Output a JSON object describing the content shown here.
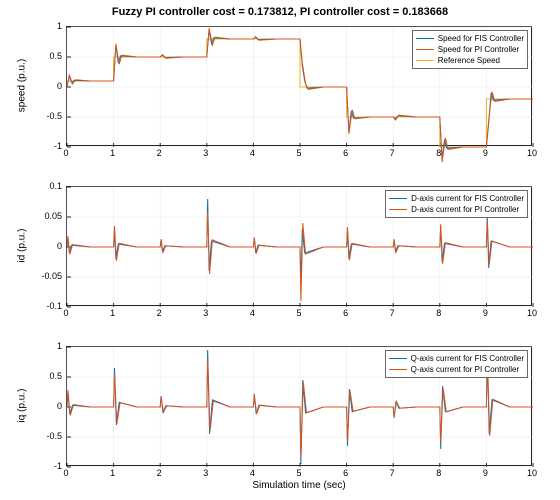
{
  "title": "Fuzzy PI controller cost = 0.173812, PI controller cost = 0.183668",
  "xlabel": "Simulation time (sec)",
  "colors": {
    "c1": "#0072BD",
    "c2": "#D95319",
    "c3": "#EDB120"
  },
  "panel1": {
    "ylabel": "speed (p.u.)",
    "xlim": [
      0,
      10
    ],
    "ylim": [
      -1,
      1
    ],
    "yticks": [
      -1,
      -0.5,
      0,
      0.5,
      1
    ],
    "legend": [
      "Speed for FIS Controller",
      "Speed for PI Controller",
      "Reference Speed"
    ]
  },
  "panel2": {
    "ylabel": "id (p.u.)",
    "xlim": [
      0,
      10
    ],
    "ylim": [
      -0.1,
      0.1
    ],
    "yticks": [
      -0.1,
      -0.05,
      0,
      0.05,
      0.1
    ],
    "legend": [
      "D-axis current for FIS Controller",
      "D-axis current for PI Controller"
    ]
  },
  "panel3": {
    "ylabel": "iq (p.u.)",
    "xlim": [
      0,
      10
    ],
    "ylim": [
      -1,
      1
    ],
    "yticks": [
      -1,
      -0.5,
      0,
      0.5,
      1
    ],
    "legend": [
      "Q-axis current for FIS Controller",
      "Q-axis current for PI Controller"
    ]
  },
  "xticks": [
    0,
    1,
    2,
    3,
    4,
    5,
    6,
    7,
    8,
    9,
    10
  ],
  "chart_data": [
    {
      "type": "line",
      "title": "Speed",
      "xlabel": "Simulation time (sec)",
      "ylabel": "speed (p.u.)",
      "xlim": [
        0,
        10
      ],
      "ylim": [
        -1,
        1
      ],
      "series": [
        {
          "name": "Reference Speed",
          "x": [
            0,
            0.999,
            1,
            1.999,
            2,
            2.999,
            3,
            3.999,
            4,
            4.999,
            5,
            5.999,
            6,
            6.999,
            7,
            7.999,
            8,
            8.999,
            9,
            10
          ],
          "values": [
            0.1,
            0.1,
            0.5,
            0.5,
            0.5,
            0.5,
            0.8,
            0.8,
            0.8,
            0.8,
            0.0,
            0.0,
            -0.5,
            -0.5,
            -0.5,
            -0.5,
            -1.0,
            -1.0,
            -0.2,
            -0.2
          ]
        },
        {
          "name": "Speed for FIS Controller",
          "x": [
            0,
            0.05,
            0.1,
            0.15,
            0.5,
            1.0,
            1.05,
            1.1,
            1.15,
            1.5,
            2.0,
            2.05,
            2.1,
            2.5,
            3.0,
            3.05,
            3.1,
            3.15,
            3.5,
            4.0,
            4.05,
            4.1,
            4.5,
            5.0,
            5.05,
            5.1,
            5.15,
            5.5,
            6.0,
            6.05,
            6.1,
            6.15,
            6.5,
            7.0,
            7.05,
            7.1,
            7.5,
            8.0,
            8.05,
            8.1,
            8.15,
            8.5,
            9.0,
            9.05,
            9.1,
            9.15,
            9.5,
            10
          ],
          "values": [
            0,
            0.18,
            0.07,
            0.11,
            0.1,
            0.1,
            0.7,
            0.4,
            0.52,
            0.5,
            0.5,
            0.53,
            0.49,
            0.5,
            0.5,
            0.95,
            0.72,
            0.82,
            0.8,
            0.8,
            0.83,
            0.79,
            0.8,
            0.8,
            0.35,
            0.1,
            -0.02,
            0.0,
            0.0,
            -0.75,
            -0.4,
            -0.52,
            -0.5,
            -0.5,
            -0.53,
            -0.48,
            -0.5,
            -0.5,
            -1.2,
            -0.88,
            -1.02,
            -1.0,
            -1.0,
            -0.6,
            -0.1,
            -0.22,
            -0.2,
            -0.2
          ]
        },
        {
          "name": "Speed for PI Controller",
          "x": [
            0,
            0.05,
            0.12,
            0.18,
            0.5,
            1.0,
            1.05,
            1.12,
            1.18,
            1.5,
            2.0,
            2.05,
            2.12,
            2.5,
            3.0,
            3.05,
            3.12,
            3.18,
            3.5,
            4.0,
            4.05,
            4.12,
            4.5,
            5.0,
            5.05,
            5.12,
            5.18,
            5.5,
            6.0,
            6.05,
            6.12,
            6.18,
            6.5,
            7.0,
            7.05,
            7.12,
            7.5,
            8.0,
            8.05,
            8.12,
            8.18,
            8.5,
            9.0,
            9.05,
            9.12,
            9.18,
            9.5,
            10
          ],
          "values": [
            0,
            0.2,
            0.05,
            0.12,
            0.1,
            0.1,
            0.72,
            0.38,
            0.53,
            0.5,
            0.5,
            0.54,
            0.48,
            0.5,
            0.5,
            0.98,
            0.7,
            0.83,
            0.8,
            0.8,
            0.84,
            0.78,
            0.8,
            0.8,
            0.4,
            0.05,
            -0.04,
            0.0,
            0.0,
            -0.78,
            -0.38,
            -0.53,
            -0.5,
            -0.5,
            -0.55,
            -0.47,
            -0.5,
            -0.5,
            -1.25,
            -0.85,
            -1.04,
            -1.0,
            -1.0,
            -0.55,
            -0.08,
            -0.24,
            -0.2,
            -0.2
          ]
        }
      ]
    },
    {
      "type": "line",
      "title": "D-axis current",
      "xlabel": "Simulation time (sec)",
      "ylabel": "id (p.u.)",
      "xlim": [
        0,
        10
      ],
      "ylim": [
        -0.1,
        0.1
      ],
      "series": [
        {
          "name": "D-axis current for FIS Controller",
          "x": [
            0,
            0.02,
            0.05,
            0.1,
            0.5,
            1.0,
            1.02,
            1.05,
            1.1,
            1.5,
            2.0,
            2.02,
            2.05,
            2.1,
            2.5,
            3.0,
            3.02,
            3.05,
            3.1,
            3.5,
            4.0,
            4.02,
            4.05,
            4.1,
            4.5,
            5.0,
            5.02,
            5.05,
            5.1,
            5.5,
            6.0,
            6.02,
            6.05,
            6.1,
            6.5,
            7.0,
            7.02,
            7.05,
            7.1,
            7.5,
            8.0,
            8.02,
            8.05,
            8.1,
            8.5,
            9.0,
            9.02,
            9.05,
            9.1,
            9.5,
            10
          ],
          "values": [
            0,
            0.015,
            -0.01,
            0.003,
            0,
            0,
            0.03,
            -0.02,
            0.005,
            0,
            0,
            0.012,
            -0.008,
            0.002,
            0,
            0,
            0.08,
            -0.04,
            0.01,
            0,
            0,
            0.015,
            -0.01,
            0.003,
            0,
            0,
            -0.06,
            0.03,
            -0.01,
            0,
            0,
            0.03,
            -0.02,
            0.005,
            0,
            0,
            0.012,
            -0.008,
            0.002,
            0,
            0,
            0.035,
            -0.025,
            0.006,
            0,
            0,
            0.05,
            -0.035,
            0.01,
            0,
            0
          ]
        },
        {
          "name": "D-axis current for PI Controller",
          "x": [
            0,
            0.02,
            0.06,
            0.12,
            0.5,
            1.0,
            1.02,
            1.06,
            1.12,
            1.5,
            2.0,
            2.02,
            2.06,
            2.12,
            2.5,
            3.0,
            3.02,
            3.06,
            3.12,
            3.5,
            4.0,
            4.02,
            4.06,
            4.12,
            4.5,
            5.0,
            5.02,
            5.06,
            5.12,
            5.5,
            6.0,
            6.02,
            6.06,
            6.12,
            6.5,
            7.0,
            7.02,
            7.06,
            7.12,
            7.5,
            8.0,
            8.02,
            8.06,
            8.12,
            8.5,
            9.0,
            9.02,
            9.06,
            9.12,
            9.5,
            10
          ],
          "values": [
            0,
            0.018,
            -0.012,
            0.004,
            0,
            0,
            0.035,
            -0.023,
            0.006,
            0,
            0,
            0.013,
            -0.009,
            0.002,
            0,
            0,
            0.06,
            -0.045,
            0.012,
            0,
            0,
            0.016,
            -0.011,
            0.003,
            0,
            0,
            -0.09,
            0.04,
            -0.012,
            0,
            0,
            0.033,
            -0.022,
            0.006,
            0,
            0,
            0.013,
            -0.009,
            0.002,
            0,
            0,
            0.038,
            -0.028,
            0.007,
            0,
            0,
            0.045,
            -0.03,
            0.01,
            0,
            0
          ]
        }
      ]
    },
    {
      "type": "line",
      "title": "Q-axis current",
      "xlabel": "Simulation time (sec)",
      "ylabel": "iq (p.u.)",
      "xlim": [
        0,
        10
      ],
      "ylim": [
        -1,
        1
      ],
      "series": [
        {
          "name": "Q-axis current for FIS Controller",
          "x": [
            0,
            0.02,
            0.06,
            0.12,
            0.5,
            1.0,
            1.02,
            1.06,
            1.12,
            1.5,
            2.0,
            2.02,
            2.06,
            2.12,
            2.5,
            3.0,
            3.02,
            3.06,
            3.12,
            3.5,
            4.0,
            4.02,
            4.06,
            4.12,
            4.5,
            5.0,
            5.02,
            5.06,
            5.12,
            5.5,
            6.0,
            6.02,
            6.06,
            6.12,
            6.5,
            7.0,
            7.02,
            7.06,
            7.12,
            7.5,
            8.0,
            8.02,
            8.06,
            8.12,
            8.5,
            9.0,
            9.02,
            9.06,
            9.12,
            9.5,
            10
          ],
          "values": [
            0,
            0.25,
            -0.12,
            0.03,
            0,
            0,
            0.65,
            -0.3,
            0.08,
            0,
            0,
            0.18,
            -0.1,
            0.02,
            0,
            0,
            0.95,
            -0.45,
            0.12,
            0,
            0,
            0.22,
            -0.12,
            0.03,
            0,
            0,
            -0.95,
            0.45,
            -0.1,
            0,
            0,
            -0.65,
            0.3,
            -0.08,
            0,
            0,
            -0.18,
            0.1,
            -0.02,
            0,
            0,
            -0.7,
            0.35,
            -0.08,
            0,
            0,
            0.9,
            -0.45,
            0.12,
            0,
            0
          ]
        },
        {
          "name": "Q-axis current for PI Controller",
          "x": [
            0,
            0.02,
            0.07,
            0.14,
            0.5,
            1.0,
            1.02,
            1.07,
            1.14,
            1.5,
            2.0,
            2.02,
            2.07,
            2.14,
            2.5,
            3.0,
            3.02,
            3.07,
            3.14,
            3.5,
            4.0,
            4.02,
            4.07,
            4.14,
            4.5,
            5.0,
            5.02,
            5.07,
            5.14,
            5.5,
            6.0,
            6.02,
            6.07,
            6.14,
            6.5,
            7.0,
            7.02,
            7.07,
            7.14,
            7.5,
            8.0,
            8.02,
            8.07,
            8.14,
            8.5,
            9.0,
            9.02,
            9.07,
            9.14,
            9.5,
            10
          ],
          "values": [
            0,
            0.28,
            -0.14,
            0.04,
            0,
            0,
            0.55,
            -0.28,
            0.07,
            0,
            0,
            0.17,
            -0.09,
            0.02,
            0,
            0,
            0.8,
            -0.4,
            0.1,
            0,
            0,
            0.2,
            -0.11,
            0.03,
            0,
            0,
            -0.85,
            0.42,
            -0.1,
            0,
            0,
            -0.58,
            0.28,
            -0.07,
            0,
            0,
            -0.17,
            0.09,
            -0.02,
            0,
            0,
            -0.62,
            0.32,
            -0.08,
            0,
            0,
            0.95,
            -0.48,
            0.13,
            0,
            0
          ]
        }
      ]
    }
  ]
}
